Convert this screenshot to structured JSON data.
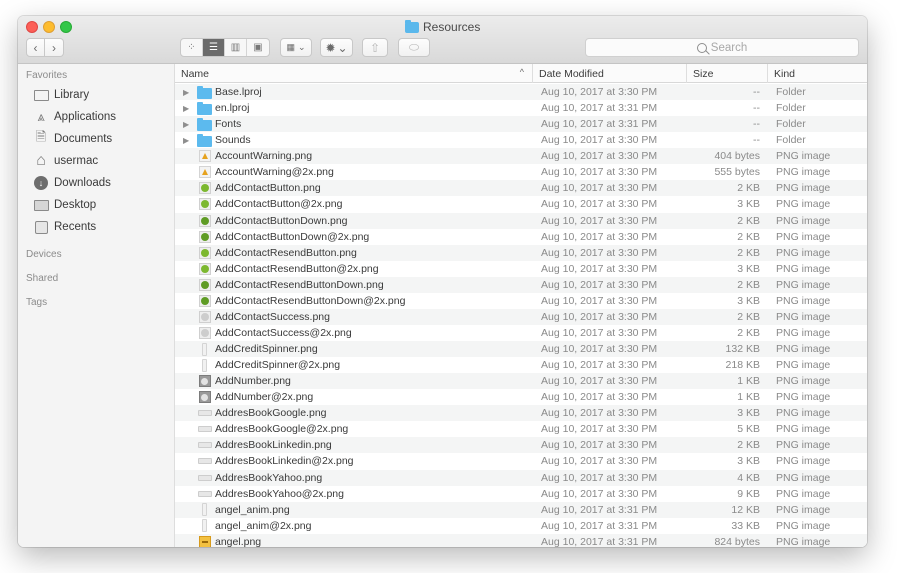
{
  "window": {
    "title": "Resources",
    "controls": {
      "close": "close",
      "minimize": "minimize",
      "zoom": "zoom"
    }
  },
  "toolbar": {
    "back_glyph": "‹",
    "forward_glyph": "›",
    "views": [
      {
        "name": "icon-view",
        "glyph": "⁘",
        "active": false
      },
      {
        "name": "list-view",
        "glyph": "☰",
        "active": true
      },
      {
        "name": "column-view",
        "glyph": "▥",
        "active": false
      },
      {
        "name": "gallery-view",
        "glyph": "▣",
        "active": false
      }
    ],
    "arrange_glyph": "▦",
    "action_glyph": "✹",
    "dropdown_glyph": "⌄",
    "share_glyph": "⇧",
    "tag_glyph": "⬭",
    "search_placeholder": "Search"
  },
  "sidebar": {
    "sections": {
      "favorites": "Favorites",
      "devices": "Devices",
      "shared": "Shared",
      "tags": "Tags"
    },
    "favorites": [
      {
        "label": "Library",
        "icon": "folder-icon"
      },
      {
        "label": "Applications",
        "icon": "applications-icon",
        "glyph": "⩓"
      },
      {
        "label": "Documents",
        "icon": "documents-icon",
        "glyph": "🗎"
      },
      {
        "label": "usermac",
        "icon": "home-icon",
        "glyph": "⌂"
      },
      {
        "label": "Downloads",
        "icon": "downloads-icon",
        "glyph": "↓"
      },
      {
        "label": "Desktop",
        "icon": "desktop-icon"
      },
      {
        "label": "Recents",
        "icon": "recents-icon"
      }
    ]
  },
  "columns": {
    "name": "Name",
    "date": "Date Modified",
    "size": "Size",
    "kind": "Kind",
    "sort_indicator": "^"
  },
  "files": [
    {
      "name": "Base.lproj",
      "date": "Aug 10, 2017 at 3:30 PM",
      "size": "--",
      "kind": "Folder",
      "icon": "folder",
      "expandable": true
    },
    {
      "name": "en.lproj",
      "date": "Aug 10, 2017 at 3:31 PM",
      "size": "--",
      "kind": "Folder",
      "icon": "folder",
      "expandable": true
    },
    {
      "name": "Fonts",
      "date": "Aug 10, 2017 at 3:31 PM",
      "size": "--",
      "kind": "Folder",
      "icon": "folder",
      "expandable": true
    },
    {
      "name": "Sounds",
      "date": "Aug 10, 2017 at 3:30 PM",
      "size": "--",
      "kind": "Folder",
      "icon": "folder",
      "expandable": true
    },
    {
      "name": "AccountWarning.png",
      "date": "Aug 10, 2017 at 3:30 PM",
      "size": "404 bytes",
      "kind": "PNG image",
      "icon": "warning"
    },
    {
      "name": "AccountWarning@2x.png",
      "date": "Aug 10, 2017 at 3:30 PM",
      "size": "555 bytes",
      "kind": "PNG image",
      "icon": "warning"
    },
    {
      "name": "AddContactButton.png",
      "date": "Aug 10, 2017 at 3:30 PM",
      "size": "2 KB",
      "kind": "PNG image",
      "icon": "green"
    },
    {
      "name": "AddContactButton@2x.png",
      "date": "Aug 10, 2017 at 3:30 PM",
      "size": "3 KB",
      "kind": "PNG image",
      "icon": "green"
    },
    {
      "name": "AddContactButtonDown.png",
      "date": "Aug 10, 2017 at 3:30 PM",
      "size": "2 KB",
      "kind": "PNG image",
      "icon": "green-dark"
    },
    {
      "name": "AddContactButtonDown@2x.png",
      "date": "Aug 10, 2017 at 3:30 PM",
      "size": "2 KB",
      "kind": "PNG image",
      "icon": "green-dark"
    },
    {
      "name": "AddContactResendButton.png",
      "date": "Aug 10, 2017 at 3:30 PM",
      "size": "2 KB",
      "kind": "PNG image",
      "icon": "green"
    },
    {
      "name": "AddContactResendButton@2x.png",
      "date": "Aug 10, 2017 at 3:30 PM",
      "size": "3 KB",
      "kind": "PNG image",
      "icon": "green"
    },
    {
      "name": "AddContactResendButtonDown.png",
      "date": "Aug 10, 2017 at 3:30 PM",
      "size": "2 KB",
      "kind": "PNG image",
      "icon": "green-dark"
    },
    {
      "name": "AddContactResendButtonDown@2x.png",
      "date": "Aug 10, 2017 at 3:30 PM",
      "size": "3 KB",
      "kind": "PNG image",
      "icon": "green-dark"
    },
    {
      "name": "AddContactSuccess.png",
      "date": "Aug 10, 2017 at 3:30 PM",
      "size": "2 KB",
      "kind": "PNG image",
      "icon": "success"
    },
    {
      "name": "AddContactSuccess@2x.png",
      "date": "Aug 10, 2017 at 3:30 PM",
      "size": "2 KB",
      "kind": "PNG image",
      "icon": "success"
    },
    {
      "name": "AddCreditSpinner.png",
      "date": "Aug 10, 2017 at 3:30 PM",
      "size": "132 KB",
      "kind": "PNG image",
      "icon": "spinner"
    },
    {
      "name": "AddCreditSpinner@2x.png",
      "date": "Aug 10, 2017 at 3:30 PM",
      "size": "218 KB",
      "kind": "PNG image",
      "icon": "spinner"
    },
    {
      "name": "AddNumber.png",
      "date": "Aug 10, 2017 at 3:30 PM",
      "size": "1 KB",
      "kind": "PNG image",
      "icon": "number"
    },
    {
      "name": "AddNumber@2x.png",
      "date": "Aug 10, 2017 at 3:30 PM",
      "size": "1 KB",
      "kind": "PNG image",
      "icon": "number"
    },
    {
      "name": "AddresBookGoogle.png",
      "date": "Aug 10, 2017 at 3:30 PM",
      "size": "3 KB",
      "kind": "PNG image",
      "icon": "bar"
    },
    {
      "name": "AddresBookGoogle@2x.png",
      "date": "Aug 10, 2017 at 3:30 PM",
      "size": "5 KB",
      "kind": "PNG image",
      "icon": "bar"
    },
    {
      "name": "AddresBookLinkedin.png",
      "date": "Aug 10, 2017 at 3:30 PM",
      "size": "2 KB",
      "kind": "PNG image",
      "icon": "bar"
    },
    {
      "name": "AddresBookLinkedin@2x.png",
      "date": "Aug 10, 2017 at 3:30 PM",
      "size": "3 KB",
      "kind": "PNG image",
      "icon": "bar"
    },
    {
      "name": "AddresBookYahoo.png",
      "date": "Aug 10, 2017 at 3:30 PM",
      "size": "4 KB",
      "kind": "PNG image",
      "icon": "bar"
    },
    {
      "name": "AddresBookYahoo@2x.png",
      "date": "Aug 10, 2017 at 3:30 PM",
      "size": "9 KB",
      "kind": "PNG image",
      "icon": "bar"
    },
    {
      "name": "angel_anim.png",
      "date": "Aug 10, 2017 at 3:31 PM",
      "size": "12 KB",
      "kind": "PNG image",
      "icon": "spinner"
    },
    {
      "name": "angel_anim@2x.png",
      "date": "Aug 10, 2017 at 3:31 PM",
      "size": "33 KB",
      "kind": "PNG image",
      "icon": "spinner"
    },
    {
      "name": "angel.png",
      "date": "Aug 10, 2017 at 3:31 PM",
      "size": "824 bytes",
      "kind": "PNG image",
      "icon": "angel"
    }
  ]
}
